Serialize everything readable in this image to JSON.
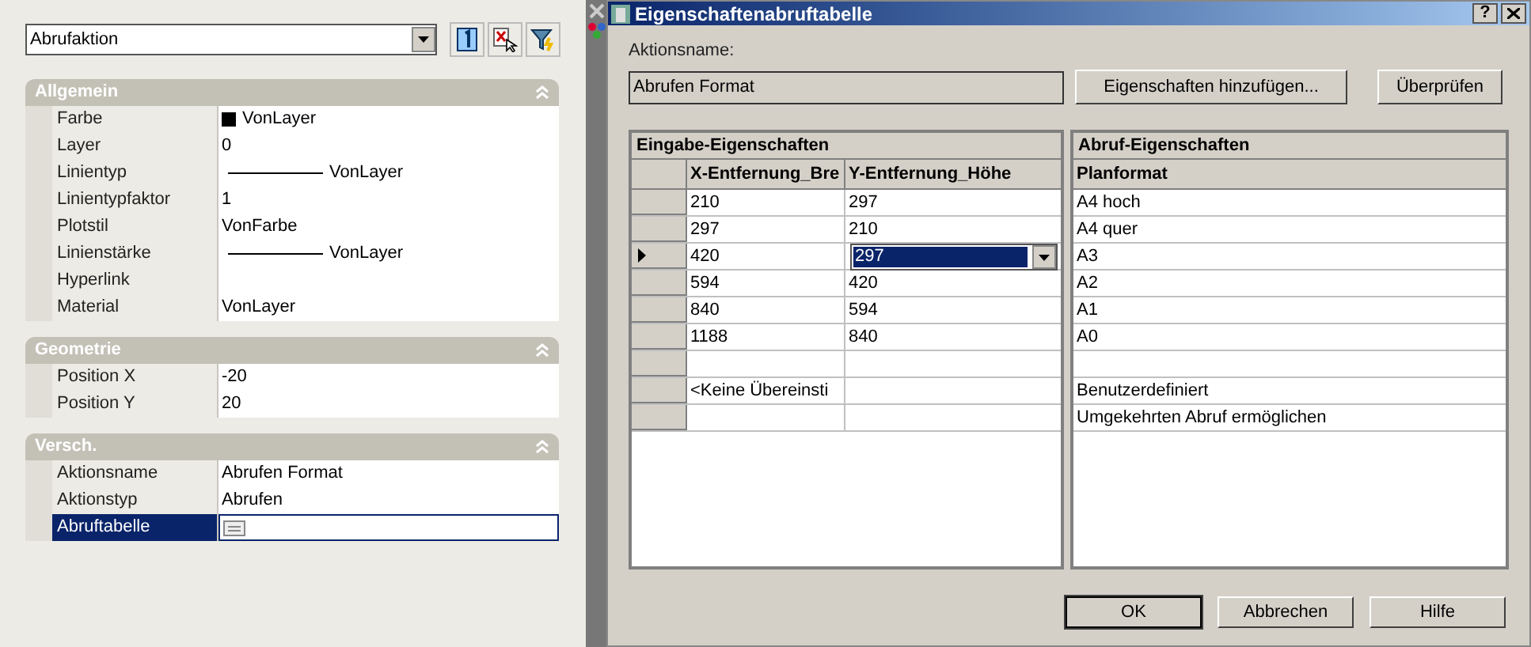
{
  "properties_panel": {
    "object_dropdown": "Abrufaktion",
    "sections": [
      {
        "title": "Allgemein",
        "expanded": true,
        "rows": [
          {
            "label": "Farbe",
            "value": "VonLayer",
            "kind": "color",
            "selected": false
          },
          {
            "label": "Layer",
            "value": "0",
            "kind": "text",
            "selected": false
          },
          {
            "label": "Linientyp",
            "value": "VonLayer",
            "kind": "line",
            "selected": false
          },
          {
            "label": "Linientypfaktor",
            "value": "1",
            "kind": "text",
            "selected": false
          },
          {
            "label": "Plotstil",
            "value": "VonFarbe",
            "kind": "text",
            "selected": false
          },
          {
            "label": "Linienstärke",
            "value": "VonLayer",
            "kind": "line",
            "selected": false
          },
          {
            "label": "Hyperlink",
            "kind": "text",
            "selected": false
          },
          {
            "label": "Material",
            "value": "VonLayer",
            "kind": "text",
            "selected": false
          }
        ]
      },
      {
        "title": "Geometrie",
        "expanded": true,
        "rows": [
          {
            "label": "Position X",
            "value": "-20",
            "kind": "text",
            "selected": false
          },
          {
            "label": "Position Y",
            "value": "20",
            "kind": "text",
            "selected": false
          }
        ]
      },
      {
        "title": "Versch.",
        "expanded": true,
        "rows": [
          {
            "label": "Aktionsname",
            "value": "Abrufen Format",
            "kind": "text",
            "selected": false
          },
          {
            "label": "Aktionstyp",
            "value": "Abrufen",
            "kind": "text",
            "selected": false
          },
          {
            "label": "Abruftabelle",
            "kind": "table",
            "selected": true
          }
        ]
      }
    ]
  },
  "dialog": {
    "title": "Eigenschaftenabruftabelle",
    "help_button": "?",
    "action_name_label": "Aktionsname:",
    "action_name_value": "Abrufen Format",
    "top_buttons": [
      "Eigenschaften hinzufügen...",
      "Überprüfen"
    ],
    "input_table": {
      "title": "Eingabe-Eigenschaften",
      "columns": [
        "X-Entfernung_Bre",
        "Y-Entfernung_Höhe"
      ],
      "rows": [
        {
          "cells": [
            "210",
            "297"
          ],
          "current": false,
          "editing": false
        },
        {
          "cells": [
            "297",
            "210"
          ],
          "current": false,
          "editing": false
        },
        {
          "cells": [
            "420",
            "297"
          ],
          "current": true,
          "editing": true
        },
        {
          "cells": [
            "594",
            "420"
          ],
          "current": false,
          "editing": false
        },
        {
          "cells": [
            "840",
            "594"
          ],
          "current": false,
          "editing": false
        },
        {
          "cells": [
            "1188",
            "840"
          ],
          "current": false,
          "editing": false
        },
        {
          "cells": [],
          "current": false,
          "editing": false
        },
        {
          "cells": [
            "<Keine Übereinsti"
          ],
          "current": false,
          "editing": false
        },
        {
          "cells": [],
          "current": false,
          "editing": false
        }
      ]
    },
    "output_table": {
      "title": "Abruf-Eigenschaften",
      "columns": [
        "Planformat"
      ],
      "rows": [
        "A4 hoch",
        "A4 quer",
        "A3",
        "A2",
        "A1",
        "A0",
        "",
        "Benutzerdefiniert",
        "Umgekehrten Abruf ermöglichen"
      ]
    },
    "bottom_buttons": [
      {
        "label": "OK",
        "default": true
      },
      {
        "label": "Abbrechen",
        "default": false
      },
      {
        "label": "Hilfe",
        "default": false
      }
    ]
  }
}
